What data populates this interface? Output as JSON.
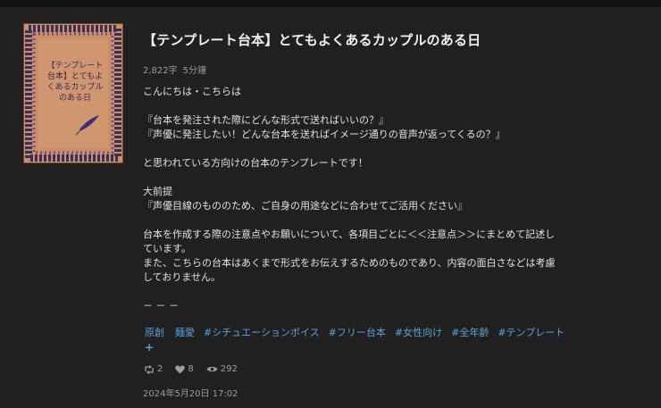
{
  "work": {
    "title": "【テンプレート台本】とてもよくあるカップルのある日",
    "cover_title": "【テンプレート\n台本】とてもよ\nくあるカップル\nのある日",
    "char_count": "2,822字",
    "read_time": "5分鐘",
    "description": [
      "こんにちは・こちらは",
      "",
      "『台本を発注された際にどんな形式で送ればいいの？』",
      "『声優に発注したい！どんな台本を送ればイメージ通りの音声が返ってくるの？』",
      "",
      "と思われている方向けの台本のテンプレートです！",
      "",
      "大前提",
      "『声優目線のもののため、ご自身の用途などに合わせてご活用ください』",
      "",
      "台本を作成する際の注意点やお願いについて、各項目ごとに＜＜注意点＞＞にまとめて記述し",
      "ています。",
      "また、こちらの台本はあくまで形式をお伝えするためのものであり、内容の面白さなどは考慮",
      "しておりません。",
      "",
      "－ － －"
    ],
    "tags": [
      "原創",
      "麺愛",
      "#シチュエーションボイス",
      "#フリー台本",
      "#女性向け",
      "#全年齢",
      "#テンプレート"
    ],
    "tag_more": "+",
    "stats": {
      "reposts": "2",
      "likes": "8",
      "views": "292"
    },
    "date": "2024年5月20日 17:02"
  },
  "colors": {
    "background": "#202020",
    "accent": "#5ba3d9",
    "cover": "#c98f68"
  }
}
